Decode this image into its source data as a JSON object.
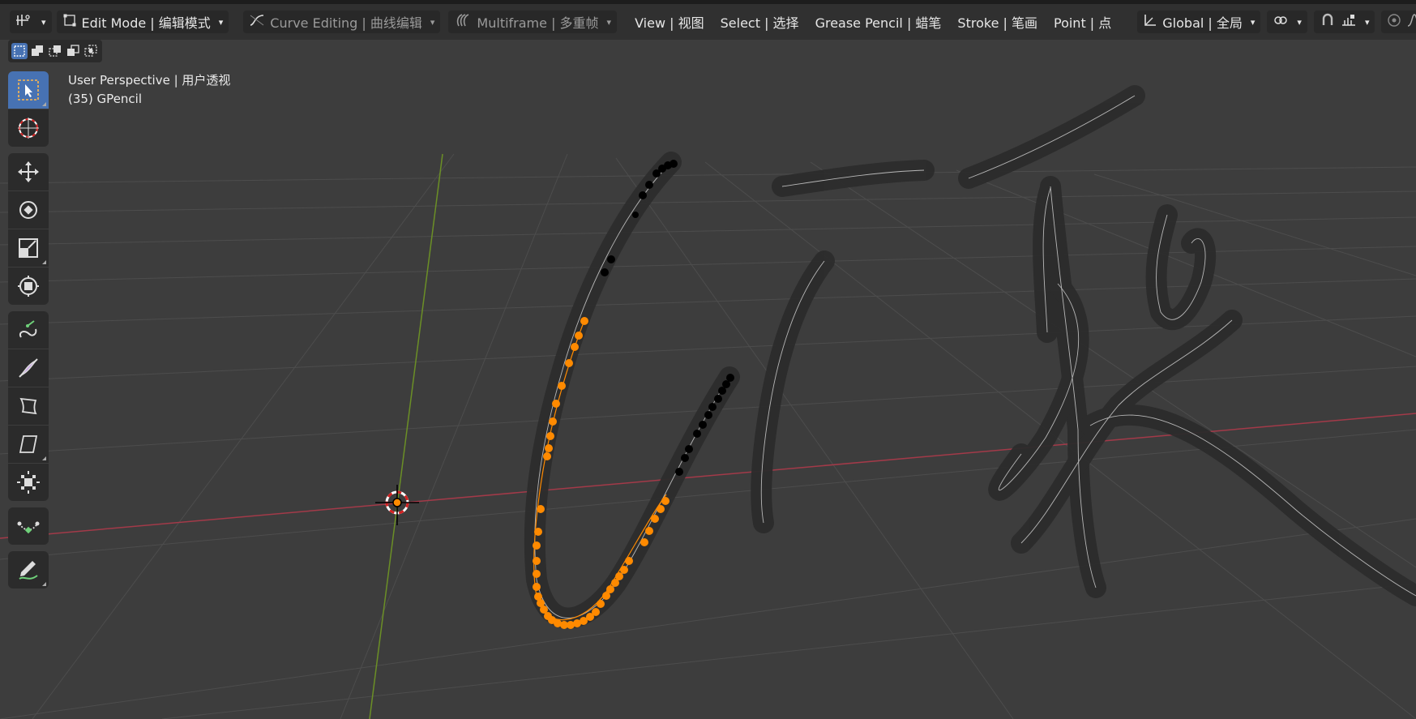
{
  "header": {
    "mode_label": "Edit Mode | 编辑模式",
    "curve_editing_label": "Curve Editing | 曲线编辑",
    "multiframe_label": "Multiframe | 多重帧",
    "menus": [
      "View | 视图",
      "Select | 选择",
      "Grease Pencil | 蜡笔",
      "Stroke | 笔画",
      "Point | 点"
    ],
    "transform_orientation": "Global | 全局"
  },
  "viewport": {
    "perspective_label": "User Perspective | 用户透视",
    "object_label": "(35) GPencil"
  },
  "toolbar": {
    "tools": [
      "select-box",
      "cursor",
      "move",
      "rotate",
      "scale",
      "transform",
      "bend",
      "shear",
      "radius",
      "envelope",
      "transform-fill",
      "interpolate",
      "annotate"
    ],
    "active_tool": "select-box"
  },
  "colors": {
    "selected_point": "#ff8a00",
    "unselected_point": "#000000",
    "x_axis": "#a33a49",
    "y_axis": "#6b8f26",
    "accent": "#4772b3"
  }
}
